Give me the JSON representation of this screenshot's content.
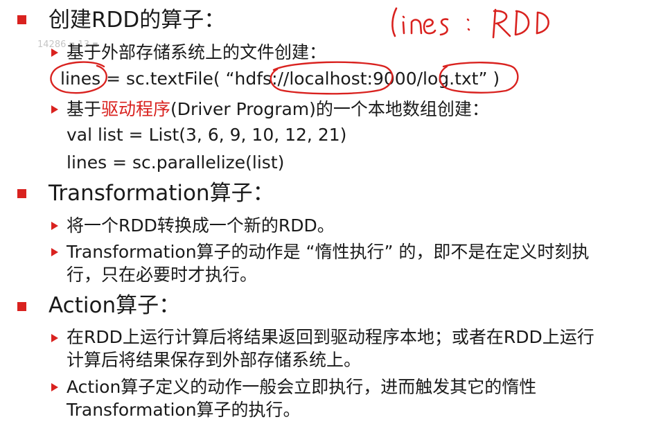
{
  "watermark": "14286 ▪ 13 ▪",
  "handwritten_note": "lines : RDD",
  "sections": [
    {
      "heading": "创建RDD的算子：",
      "items": [
        {
          "bullet": "基于外部存储系统上的文件创建："
        },
        {
          "code": "lines = sc.textFile( “hdfs://localhost:9000/log.txt” )"
        },
        {
          "bullet_prefix": "基于",
          "bullet_highlight": "驱动程序",
          "bullet_suffix": "(Driver Program)的一个本地数组创建："
        },
        {
          "code": "val list = List(3, 6, 9, 10, 12, 21)"
        },
        {
          "code": "lines = sc.parallelize(list)"
        }
      ]
    },
    {
      "heading": "Transformation算子：",
      "items": [
        {
          "bullet": "将一个RDD转换成一个新的RDD。"
        },
        {
          "bullet_line1": "Transformation算子的动作是 “惰性执行” 的，即不是在定义时刻执",
          "bullet_line2": "行，只在必要时才执行。"
        }
      ]
    },
    {
      "heading": "Action算子：",
      "items": [
        {
          "bullet_line1": "在RDD上运行计算后将结果返回到驱动程序本地；或者在RDD上运行",
          "bullet_line2": "计算后将结果保存到外部存储系统上。"
        },
        {
          "bullet_line1": "Action算子定义的动作一般会立即执行，进而触发其它的惰性",
          "bullet_line2": "Transformation算子的执行。"
        }
      ]
    }
  ],
  "colors": {
    "bullet_red": "#d9221f",
    "ink": "#d9221f",
    "text": "#1a1a1a"
  }
}
